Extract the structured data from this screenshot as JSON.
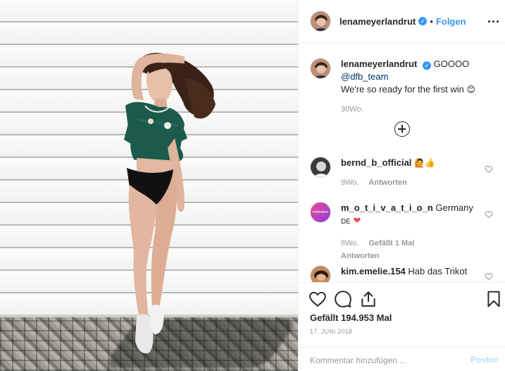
{
  "post_author": {
    "username": "lenameyerlandrut",
    "follow_label": "Folgen",
    "separator": "•"
  },
  "caption": {
    "username": "lenameyerlandrut",
    "text_line1": "GOOOO",
    "mention": "@dfb_team",
    "text_line2": "We're so ready for the first win",
    "emoji": "😊",
    "age": "30Wo."
  },
  "comments": [
    {
      "username": "bernd_b_official",
      "text": "🙋👍",
      "age": "9Wo.",
      "reply_label": "Antworten"
    },
    {
      "username": "m_o_t_i_v_a_t_i_o_n",
      "text": "Germany",
      "text2": "DE",
      "heart": "❤",
      "age": "8Wo.",
      "likes_label": "Gefällt 1 Mal",
      "reply_label": "Antworten",
      "avatar_text": "motivation"
    },
    {
      "username": "kim.emelie.154",
      "text": "Hab das Trikot"
    }
  ],
  "likes": {
    "label": "Gefällt 194.953 Mal"
  },
  "date": "17. JUNI 2018",
  "add_comment": {
    "placeholder": "Kommentar hinzufügen ...",
    "post_label": "Posten"
  },
  "icons": {
    "verified": "verified-badge-icon",
    "more": "more-options-icon",
    "load_more": "plus-circle-icon",
    "like": "heart-icon",
    "comment": "comment-bubble-icon",
    "share": "share-icon",
    "save": "bookmark-icon"
  },
  "colors": {
    "accent": "#3897f0",
    "verified": "#3897f0",
    "text": "#262626",
    "muted": "#999999",
    "post_disabled": "#b2dffc"
  }
}
